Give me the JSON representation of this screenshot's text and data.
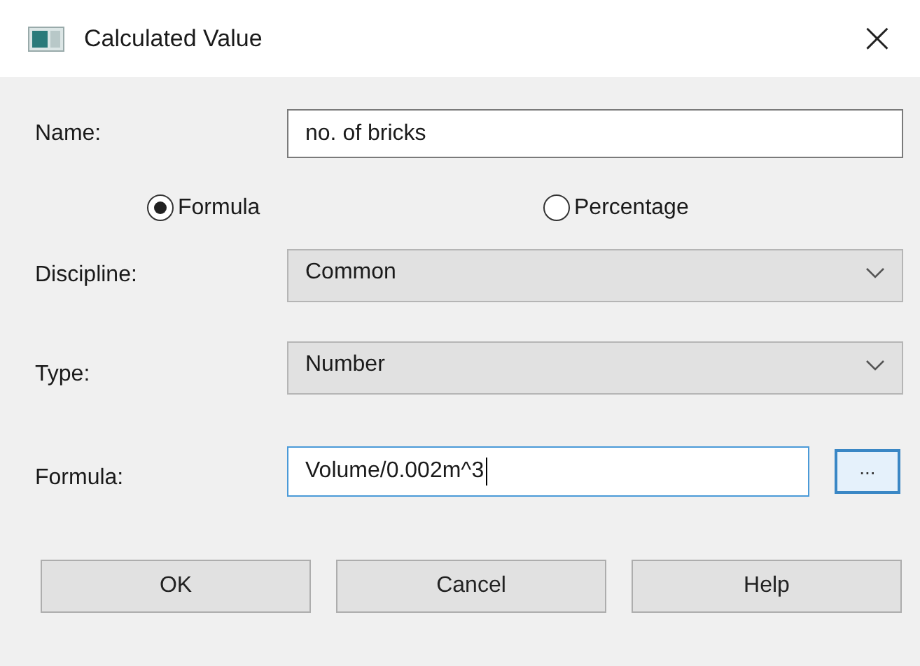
{
  "window": {
    "title": "Calculated Value",
    "close": "×"
  },
  "name_field": {
    "label": "Name:",
    "value": "no. of bricks"
  },
  "mode": [
    {
      "label": "Formula",
      "selected": true
    },
    {
      "label": "Percentage",
      "selected": false
    }
  ],
  "discipline": {
    "label": "Discipline:",
    "value": "Common"
  },
  "type": {
    "label": "Type:",
    "value": "Number"
  },
  "formula": {
    "label": "Formula:",
    "value": "Volume/0.002m^3",
    "button": "..."
  },
  "buttons": [
    "OK",
    "Cancel",
    "Help"
  ]
}
